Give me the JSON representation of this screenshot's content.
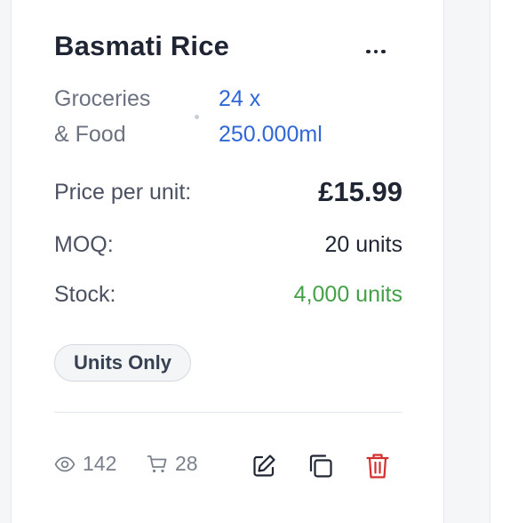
{
  "product": {
    "name": "Basmati Rice",
    "category_line1": "Groceries",
    "category_line2": "& Food",
    "pack_line1": "24 x",
    "pack_line2": "250.000ml"
  },
  "details": [
    {
      "label": "Price per unit:",
      "value": "£15.99"
    },
    {
      "label": "MOQ:",
      "value": "20 units"
    },
    {
      "label": "Stock:",
      "value": "4,000 units"
    }
  ],
  "badge": "Units Only",
  "stats": {
    "views": "142",
    "cart": "28"
  },
  "colors": {
    "pack": "#2f66d8",
    "stock": "#43a047",
    "delete": "#d32f2f"
  },
  "icons": [
    "more-options-icon",
    "eye-icon",
    "cart-icon",
    "edit-icon",
    "copy-icon",
    "trash-icon"
  ]
}
